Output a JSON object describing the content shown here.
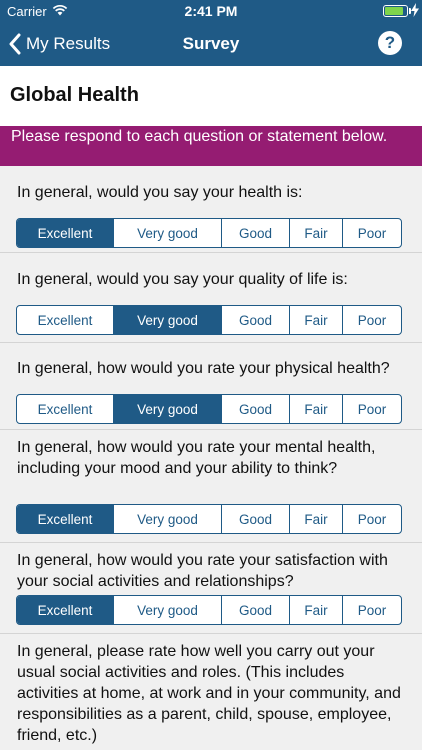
{
  "status_bar": {
    "carrier": "Carrier",
    "time": "2:41 PM",
    "battery_level": 0.9,
    "wifi_icon": "wifi-icon",
    "charging_icon": "bolt-icon"
  },
  "nav": {
    "back_label": "My Results",
    "title": "Survey",
    "help_label": "?"
  },
  "page_title": "Global Health",
  "banner": "Please respond to each question or statement below.",
  "colors": {
    "nav": "#1f5a86",
    "banner": "#951c72",
    "selected": "#1f5a86"
  },
  "options": [
    "Excellent",
    "Very good",
    "Good",
    "Fair",
    "Poor"
  ],
  "questions": [
    {
      "text": "In general, would you say your health is:",
      "selected": "Excellent"
    },
    {
      "text": "In general, would you say your quality of life is:",
      "selected": "Very good"
    },
    {
      "text": "In general, how would you rate your physical health?",
      "selected": "Very good"
    },
    {
      "text": "In general, how would you rate your mental health, including your mood and your ability to think?",
      "selected": "Excellent"
    },
    {
      "text": "In general, how would you rate your satisfaction with your social activities and relationships?",
      "selected": "Excellent"
    },
    {
      "text": "In general, please rate how well you carry out your usual social activities and roles. (This includes activities at home, at work and in your community, and responsibilities as a parent, child, spouse, employee, friend, etc.)",
      "selected": ""
    }
  ]
}
